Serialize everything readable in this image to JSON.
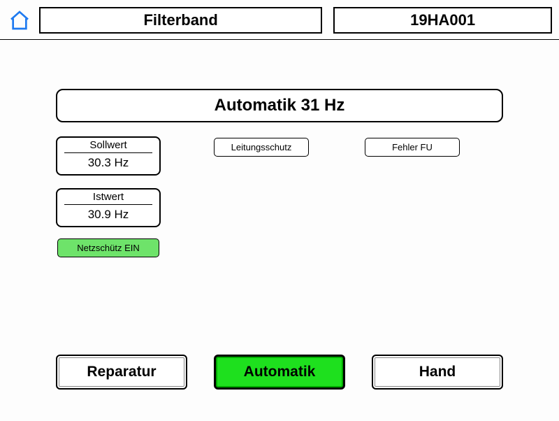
{
  "header": {
    "title": "Filterband",
    "code": "19HA001"
  },
  "status": {
    "mode_label": "Automatik 31 Hz"
  },
  "setpoint": {
    "label": "Sollwert",
    "value": "30.3 Hz"
  },
  "actual": {
    "label": "Istwert",
    "value": "30.9 Hz"
  },
  "indicators": {
    "leitungsschutz": "Leitungsschutz",
    "fehler_fu": "Fehler FU",
    "netzschuetz": "Netzschütz EIN"
  },
  "buttons": {
    "reparatur": "Reparatur",
    "automatik": "Automatik",
    "hand": "Hand"
  }
}
